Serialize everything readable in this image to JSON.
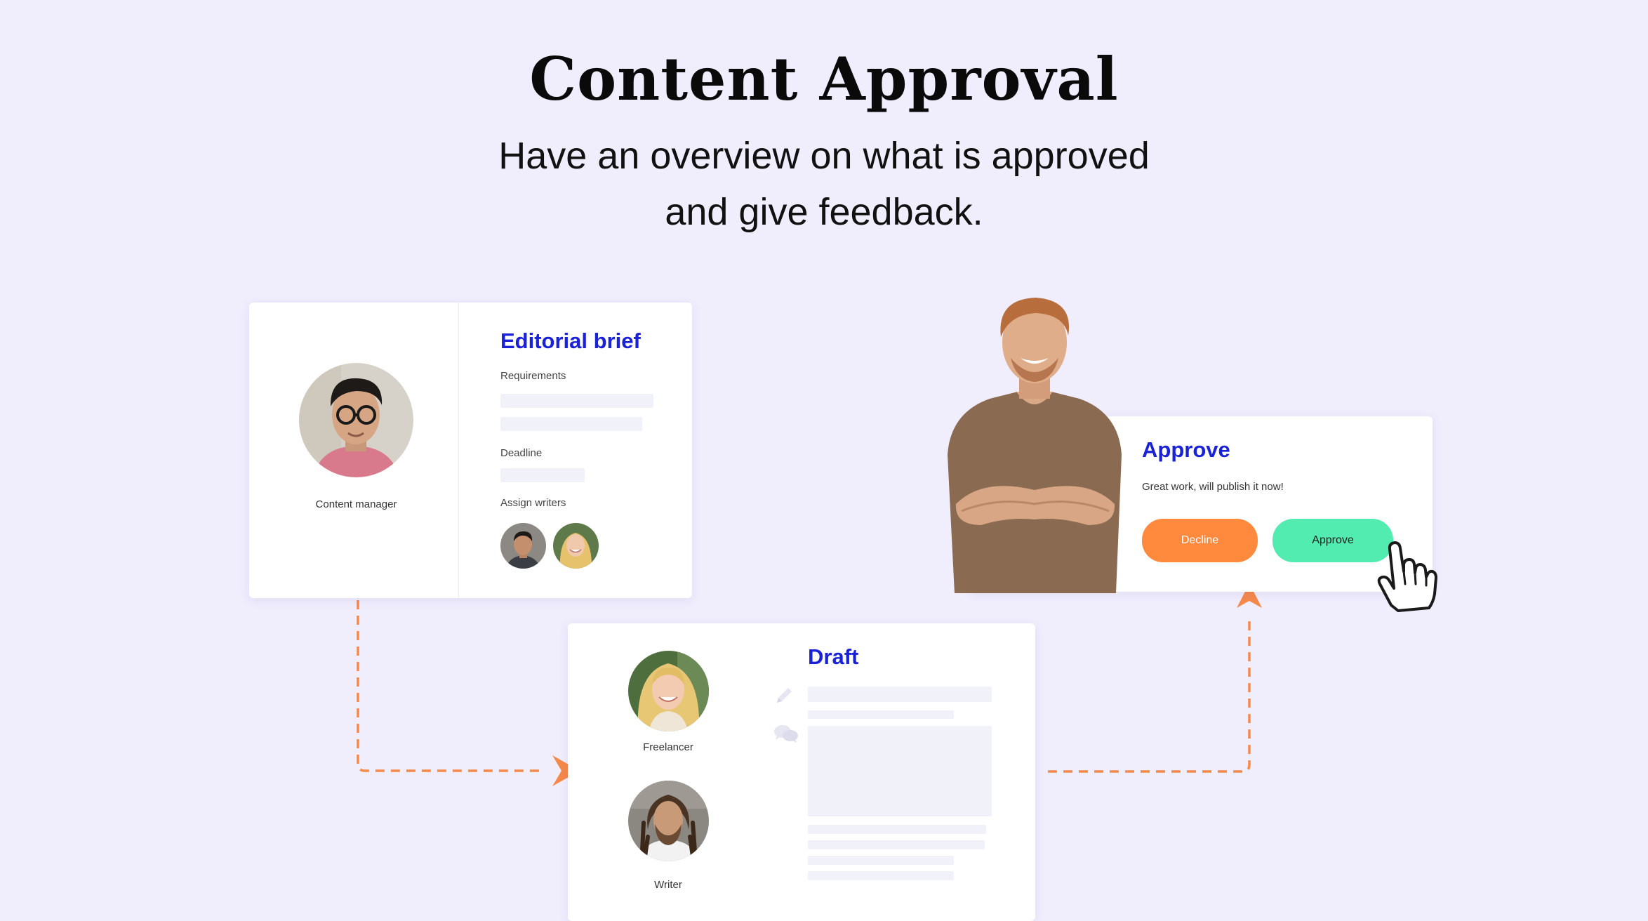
{
  "header": {
    "title": "Content Approval",
    "subtitle_line1": "Have an overview on what is approved",
    "subtitle_line2": "and give feedback."
  },
  "brief_card": {
    "title": "Editorial brief",
    "requirements_label": "Requirements",
    "deadline_label": "Deadline",
    "assign_label": "Assign writers",
    "manager_caption": "Content manager"
  },
  "draft_card": {
    "title": "Draft",
    "freelancer_caption": "Freelancer",
    "writer_caption": "Writer"
  },
  "approve_card": {
    "title": "Approve",
    "message": "Great work, will publish it now!",
    "decline_label": "Decline",
    "approve_label": "Approve"
  },
  "icons": {
    "edit": "pencil-icon",
    "comment": "chat-bubbles-icon",
    "cursor": "hand-pointer-icon",
    "flow_arrow": "arrow-head-icon"
  },
  "colors": {
    "background": "#f0eefd",
    "accent_title": "#1a22d8",
    "flow_line": "#f5894a",
    "decline": "#ff8a3d",
    "approve": "#52ebb0"
  }
}
